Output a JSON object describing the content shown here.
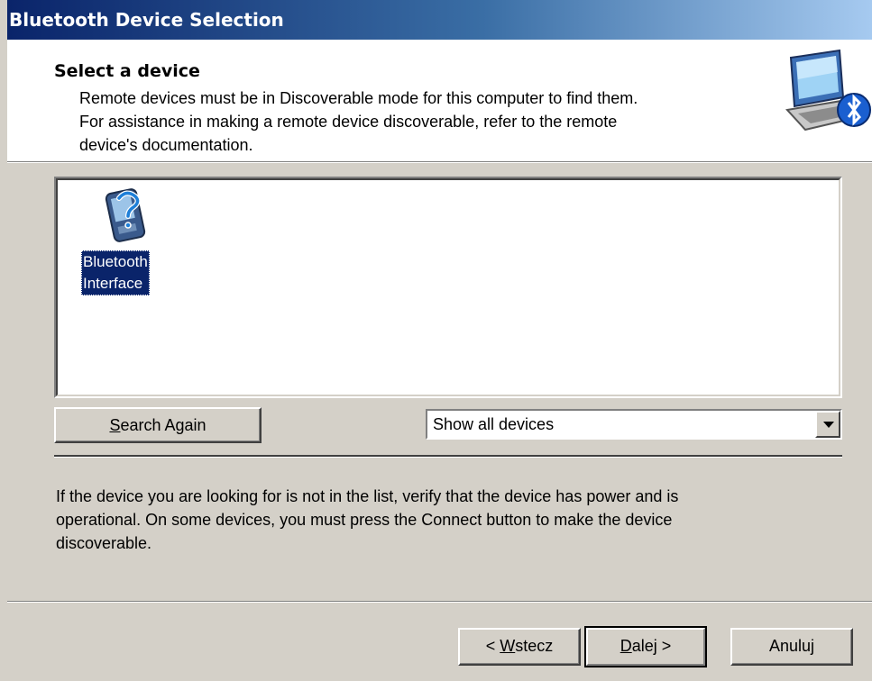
{
  "window": {
    "title": "Bluetooth Device Selection"
  },
  "header": {
    "title": "Select a device",
    "description_lines": [
      "Remote devices must be in Discoverable mode for this computer to find them.",
      "For assistance in making a remote device discoverable, refer to the remote",
      "device's documentation."
    ],
    "icon": "computer-bluetooth-icon"
  },
  "device_list": {
    "items": [
      {
        "label_line1": "Bluetooth",
        "label_line2": "Interface",
        "icon": "pda-unknown-icon",
        "selected": true
      }
    ]
  },
  "search_button": {
    "label_pre": "",
    "label_accel": "S",
    "label_post": "earch Again"
  },
  "filter": {
    "selected": "Show all devices"
  },
  "info_lines": [
    "If the device you are looking for is not in the list, verify that the device has power and is",
    "operational. On some devices, you must press the Connect button to make the device",
    "discoverable."
  ],
  "buttons": {
    "back": {
      "pre": "< ",
      "accel": "W",
      "post": "stecz"
    },
    "next": {
      "pre": "",
      "accel": "D",
      "post": "alej >"
    },
    "cancel": "Anuluj"
  },
  "colors": {
    "title_start": "#0a246a",
    "title_end": "#a6caf0",
    "face": "#d4d0c8",
    "selection": "#0a246a"
  }
}
